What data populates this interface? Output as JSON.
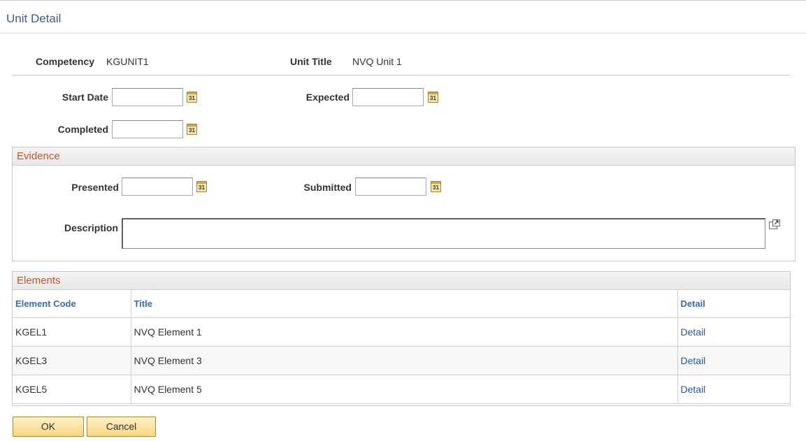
{
  "page": {
    "title": "Unit Detail"
  },
  "summary": {
    "competency_label": "Competency",
    "competency_value": "KGUNIT1",
    "unit_title_label": "Unit Title",
    "unit_title_value": "NVQ Unit 1"
  },
  "dates": {
    "start_date_label": "Start Date",
    "start_date_value": "",
    "expected_label": "Expected",
    "expected_value": "",
    "completed_label": "Completed",
    "completed_value": "",
    "calendar_glyph": "31"
  },
  "evidence": {
    "title": "Evidence",
    "presented_label": "Presented",
    "presented_value": "",
    "submitted_label": "Submitted",
    "submitted_value": "",
    "description_label": "Description",
    "description_value": ""
  },
  "elements": {
    "title": "Elements",
    "columns": [
      "Element Code",
      "Title",
      "Detail"
    ],
    "rows": [
      {
        "code": "KGEL1",
        "title": "NVQ Element 1",
        "detail": "Detail"
      },
      {
        "code": "KGEL3",
        "title": "NVQ Element 3",
        "detail": "Detail"
      },
      {
        "code": "KGEL5",
        "title": "NVQ Element 5",
        "detail": "Detail"
      }
    ]
  },
  "buttons": {
    "ok": "OK",
    "cancel": "Cancel"
  },
  "colors": {
    "title_blue": "#3c5a97",
    "group_title_orange": "#c2562c",
    "link_blue": "#1f5ba8",
    "button_fill": "#f6d77e"
  }
}
